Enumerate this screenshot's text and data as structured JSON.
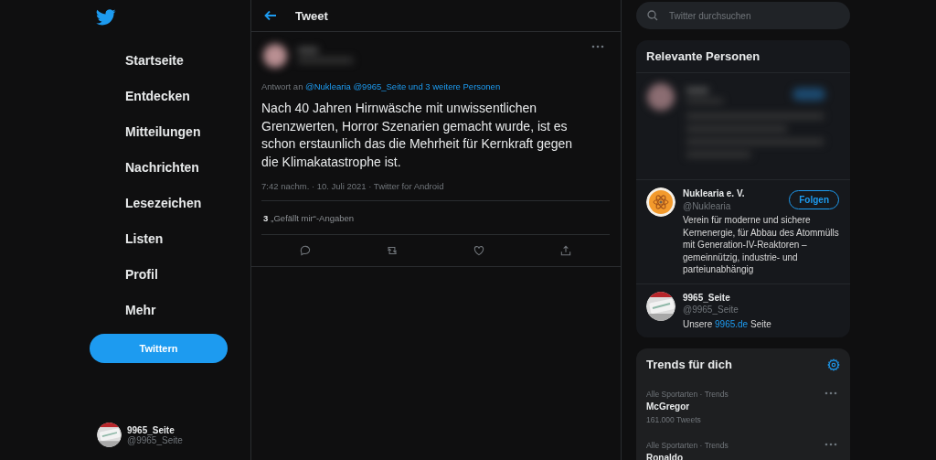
{
  "nav": {
    "items": [
      {
        "label": "Startseite"
      },
      {
        "label": "Entdecken"
      },
      {
        "label": "Mitteilungen"
      },
      {
        "label": "Nachrichten"
      },
      {
        "label": "Lesezeichen"
      },
      {
        "label": "Listen"
      },
      {
        "label": "Profil"
      },
      {
        "label": "Mehr"
      }
    ],
    "tweet_button": "Twittern",
    "account": {
      "name": "9965_Seite",
      "handle": "@9965_Seite"
    }
  },
  "main": {
    "title": "Tweet",
    "tweet": {
      "reply_prefix": "Antwort an",
      "reply_link": "@Nuklearia @9965_Seite und 3 weitere Personen",
      "text": "Nach 40 Jahren Hirnwäsche mit unwissentlichen Grenzwerten, Horror Szenarien gemacht wurde, ist es schon erstaunlich das die Mehrheit für Kernkraft gegen die Klimakatastrophe ist.",
      "meta": "7:42 nachm. · 10. Juli 2021 · Twitter for Android",
      "likes_count": "3",
      "likes_label": "„Gefällt mir“-Angaben"
    }
  },
  "search": {
    "placeholder": "Twitter durchsuchen"
  },
  "relevant": {
    "title": "Relevante Personen",
    "people": [
      {
        "kind": "blurred"
      },
      {
        "kind": "account",
        "avatar": {
          "kind": "atom"
        },
        "name": "Nuklearia e. V.",
        "handle": "@Nuklearia",
        "follow": "Folgen",
        "bio": "Verein für moderne und sichere Kernenergie, für Abbau des Atommülls mit Generation-IV-Reaktoren – gemeinnützig, industrie- und parteiunabhängig"
      },
      {
        "kind": "account",
        "avatar": {
          "kind": "logo"
        },
        "name": "9965_Seite",
        "handle": "@9965_Seite",
        "bio_before": "Unsere",
        "bio_link": "9965.de",
        "bio_after": "Seite"
      }
    ]
  },
  "trends": {
    "title": "Trends für dich",
    "items": [
      {
        "context": "Alle Sportarten · Trends",
        "name": "McGregor",
        "count": "161.000 Tweets"
      },
      {
        "context": "Alle Sportarten · Trends",
        "name": "Ronaldo"
      }
    ]
  }
}
